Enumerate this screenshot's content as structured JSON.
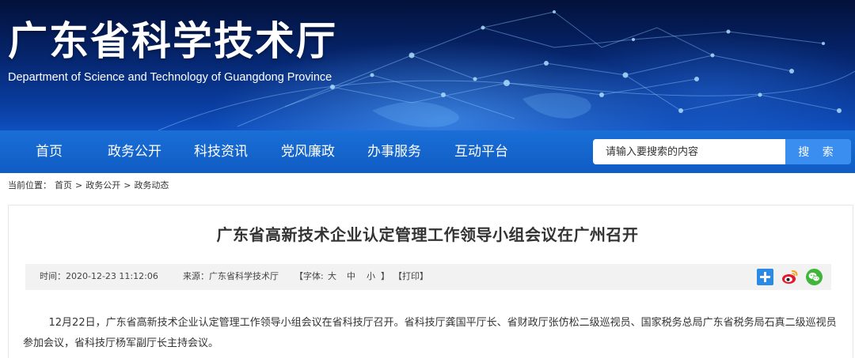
{
  "site": {
    "title": "广东省科学技术厅",
    "subtitle": "Department of Science and Technology of Guangdong Province"
  },
  "nav": {
    "items": [
      {
        "label": "首页"
      },
      {
        "label": "政务公开"
      },
      {
        "label": "科技资讯"
      },
      {
        "label": "党风廉政"
      },
      {
        "label": "办事服务"
      },
      {
        "label": "互动平台"
      }
    ],
    "search": {
      "placeholder": "请输入要搜索的内容",
      "button_label": "搜 索"
    }
  },
  "breadcrumb": {
    "prefix": "当前位置：",
    "items": [
      "首页",
      "政务公开",
      "政务动态"
    ],
    "separator": ">"
  },
  "article": {
    "title": "广东省高新技术企业认定管理工作领导小组会议在广州召开",
    "meta": {
      "time": "时间：2020-12-23 11:12:06",
      "source": "来源：广东省科学技术厅",
      "font_prefix": "【字体:",
      "font_large": "大",
      "font_medium": "中",
      "font_small": "小",
      "font_suffix": "】",
      "print": "【打印】"
    },
    "paragraphs": [
      "12月22日，广东省高新技术企业认定管理工作领导小组会议在省科技厅召开。省科技厅龚国平厅长、省财政厅张仿松二级巡视员、国家税务总局广东省税务局石真二级巡视员参加会议，省科技厅杨军副厅长主持会议。"
    ]
  },
  "share": {
    "icons": [
      "share-plus-icon",
      "weibo-icon",
      "wechat-icon"
    ],
    "colors": {
      "plus": "#2a8ae6",
      "weibo": "#e6162d",
      "wechat": "#3fb639"
    }
  },
  "colors": {
    "banner": "#06266f",
    "nav": "#1565cf",
    "search_button": "#3a8ef0",
    "meta_bar": "#f2f2f2"
  }
}
